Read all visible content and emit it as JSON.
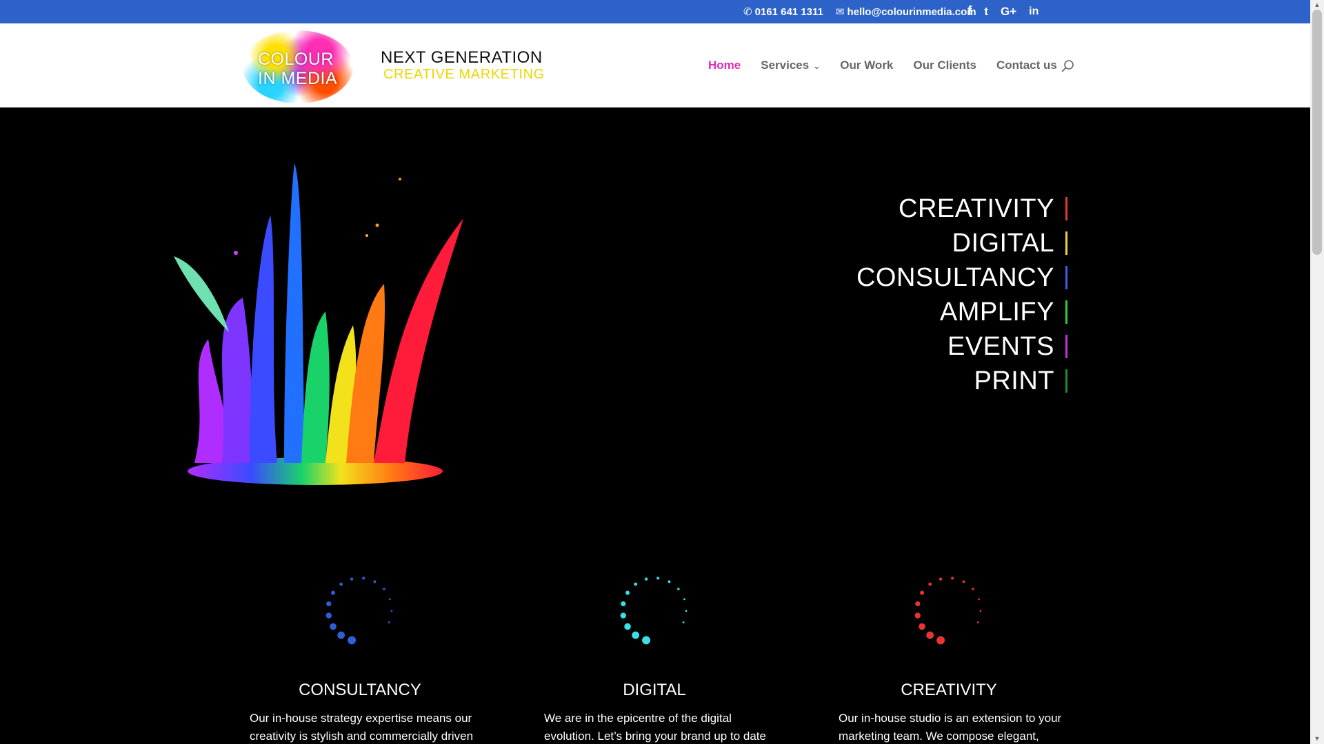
{
  "topbar": {
    "phone": "0161 641 1311",
    "email": "hello@colourinmedia.com",
    "social": [
      "f",
      "t",
      "G+",
      "in"
    ],
    "social_icons": [
      "facebook-icon",
      "twitter-icon",
      "google-plus-icon",
      "linkedin-icon"
    ]
  },
  "brand": {
    "logo_line1": "COLOUR",
    "logo_line2": "IN MEDIA",
    "tagline1": "NEXT GENERATION",
    "tagline2": "CREATIVE MARKETING"
  },
  "nav": {
    "items": [
      "Home",
      "Services",
      "Our Work",
      "Our Clients",
      "Contact us"
    ],
    "active": "Home"
  },
  "hero": {
    "words": [
      {
        "text": "CREATIVITY",
        "color": "#e53935"
      },
      {
        "text": "DIGITAL",
        "color": "#f3d23a"
      },
      {
        "text": "CONSULTANCY",
        "color": "#3d5fe0"
      },
      {
        "text": "AMPLIFY",
        "color": "#38c938"
      },
      {
        "text": "EVENTS",
        "color": "#c931d6"
      },
      {
        "text": "PRINT",
        "color": "#1f8a3a"
      }
    ]
  },
  "features": [
    {
      "title": "CONSULTANCY",
      "text": "Our in-house strategy expertise means our creativity is stylish and commercially driven",
      "color": "#2f5fd6"
    },
    {
      "title": "DIGITAL",
      "text": "We are in the epicentre of the digital evolution. Let’s bring your brand up to date to skyrocket",
      "color": "#38e0e8"
    },
    {
      "title": "CREATIVITY",
      "text": "Our in-house studio is an extension to your marketing team.  We compose elegant, stylish",
      "color": "#e8352f"
    }
  ]
}
